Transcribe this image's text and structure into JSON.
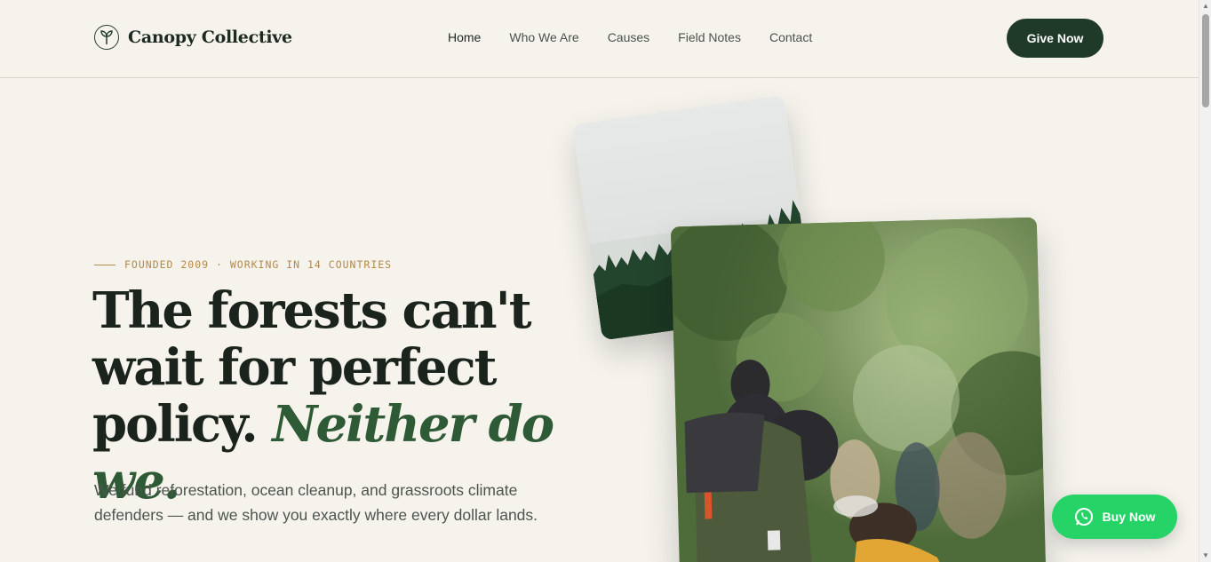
{
  "brand": {
    "name": "Canopy Collective",
    "icon": "sprout-icon"
  },
  "nav": {
    "items": [
      {
        "label": "Home",
        "active": true
      },
      {
        "label": "Who We Are",
        "active": false
      },
      {
        "label": "Causes",
        "active": false
      },
      {
        "label": "Field Notes",
        "active": false
      },
      {
        "label": "Contact",
        "active": false
      }
    ]
  },
  "header": {
    "cta_label": "Give Now"
  },
  "hero": {
    "eyebrow": "FOUNDED 2009 · WORKING IN 14 COUNTRIES",
    "headline_main": "The forests can't wait for perfect policy.",
    "headline_accent": "Neither do we.",
    "subtext": "We fund reforestation, ocean cleanup, and grassroots climate defenders — and we show you exactly where every dollar lands."
  },
  "floating": {
    "buy_label": "Buy Now",
    "icon": "whatsapp-icon"
  },
  "colors": {
    "background": "#f5f3ec",
    "primary_dark": "#1f3a28",
    "accent_green": "#2f5a36",
    "eyebrow_gold": "#b28a4a",
    "whatsapp_green": "#25d366"
  }
}
